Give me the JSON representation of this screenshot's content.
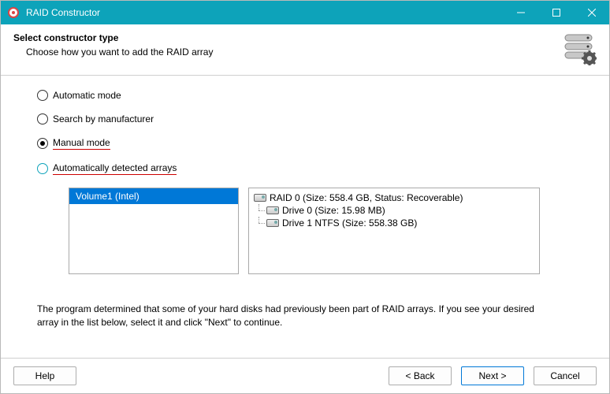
{
  "window": {
    "title": "RAID Constructor"
  },
  "header": {
    "title": "Select constructor type",
    "subtitle": "Choose how you want to add the RAID array"
  },
  "options": {
    "auto": "Automatic mode",
    "manufacturer": "Search by manufacturer",
    "manual": "Manual mode",
    "detected": "Automatically detected arrays"
  },
  "detected": {
    "volumes": [
      "Volume1 (Intel)"
    ],
    "tree": {
      "root": "RAID 0 (Size: 558.4 GB, Status: Recoverable)",
      "children": [
        "Drive 0 (Size: 15.98 MB)",
        "Drive 1 NTFS (Size: 558.38 GB)"
      ]
    }
  },
  "info": "The program determined that some of your hard disks had previously been part of RAID arrays. If you see your desired array in the list below, select it and click \"Next\" to continue.",
  "footer": {
    "help": "Help",
    "back": "< Back",
    "next": "Next >",
    "cancel": "Cancel"
  }
}
